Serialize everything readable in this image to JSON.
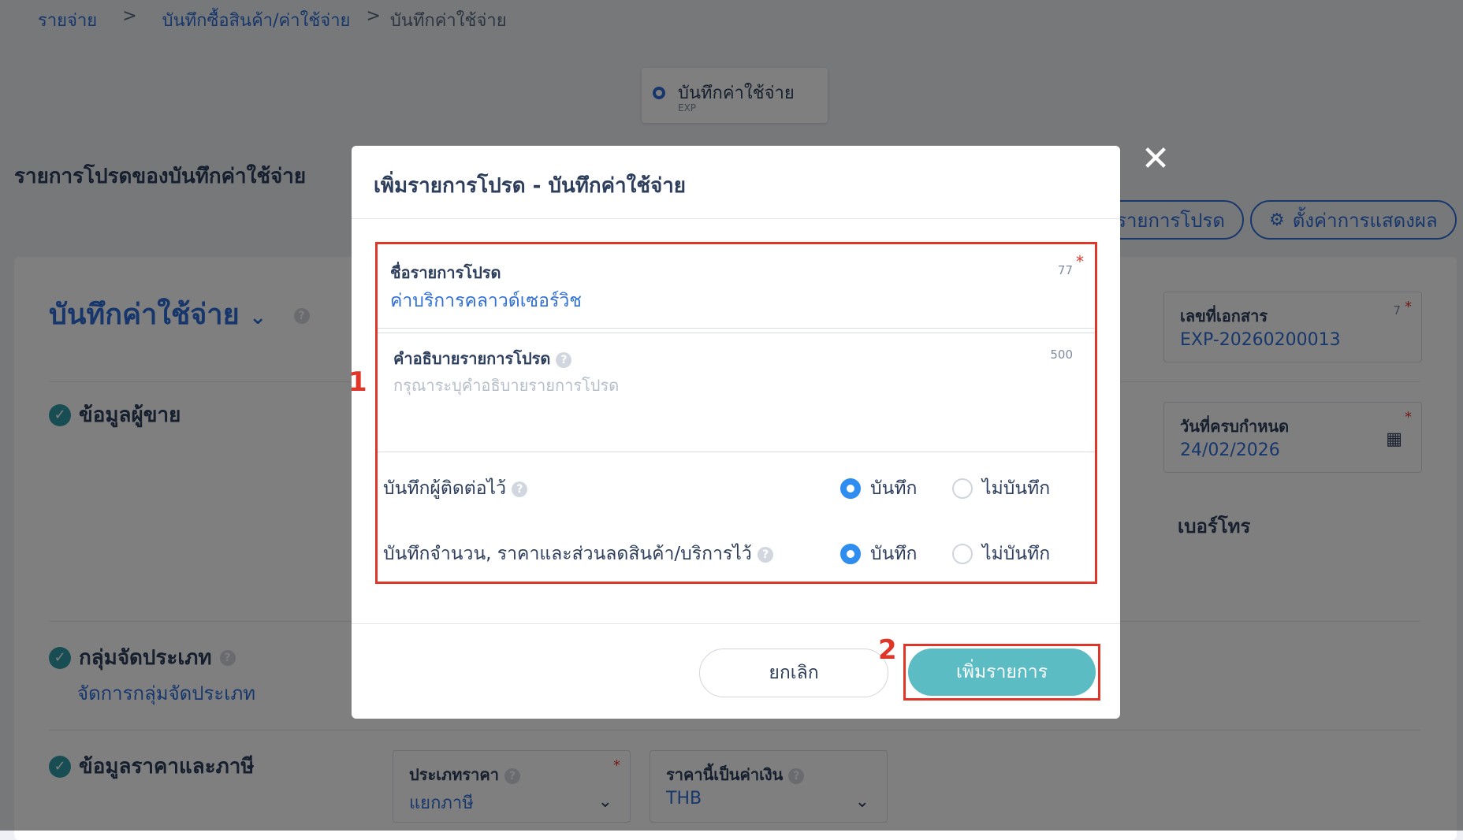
{
  "breadcrumb": {
    "items": [
      "รายจ่าย",
      "บันทึกซื้อสินค้า/ค่าใช้จ่าย"
    ],
    "current": "บันทึกค่าใช้จ่าย",
    "separator": ">"
  },
  "doc_type": {
    "label": "บันทึกค่าใช้จ่าย",
    "code": "EXP"
  },
  "favorites_title": "รายการโปรดของบันทึกค่าใช้จ่าย",
  "pills": {
    "list_label": "รายการโปรด",
    "settings_label": "ตั้งค่าการแสดงผล",
    "settings_icon": "gear-icon"
  },
  "card": {
    "title": "บันทึกค่าใช้จ่าย"
  },
  "sections": {
    "seller": "ข้อมูลผู้ขาย",
    "group": "กลุ่มจัดประเภท",
    "group_link": "จัดการกลุ่มจัดประเภท",
    "price_tax": "ข้อมูลราคาและภาษี"
  },
  "fields": {
    "doc_no": {
      "label": "เลขที่เอกสาร",
      "value": "EXP-20260200013",
      "count": "7"
    },
    "due_date": {
      "label": "วันที่ครบกำหนด",
      "value": "24/02/2026"
    },
    "phone_label": "เบอร์โทร",
    "price_type": {
      "label": "ประเภทราคา",
      "value": "แยกภาษี"
    },
    "currency": {
      "label": "ราคานี้เป็นค่าเงิน",
      "value": "THB"
    }
  },
  "modal": {
    "title": "เพิ่มรายการโปรด - บันทึกค่าใช้จ่าย",
    "name_field": {
      "label": "ชื่อรายการโปรด",
      "value": "ค่าบริการคลาวด์เซอร์วิช",
      "count": "77"
    },
    "desc_field": {
      "label": "คำอธิบายรายการโปรด",
      "placeholder": "กรุณาระบุคำอธิบายรายการโปรด",
      "count": "500"
    },
    "save_contact": {
      "label": "บันทึกผู้ติดต่อไว้",
      "opt_yes": "บันทึก",
      "opt_no": "ไม่บันทึก",
      "selected": "yes"
    },
    "save_qty": {
      "label": "บันทึกจำนวน, ราคาและส่วนลดสินค้า/บริการไว้",
      "opt_yes": "บันทึก",
      "opt_no": "ไม่บันทึก",
      "selected": "yes"
    },
    "cancel_label": "ยกเลิก",
    "add_label": "เพิ่มรายการ"
  },
  "annotations": {
    "step1": "1",
    "step2": "2"
  },
  "colors": {
    "accent": "#2f6fd8",
    "teal": "#5bbcc4",
    "highlight": "#e0362a"
  }
}
